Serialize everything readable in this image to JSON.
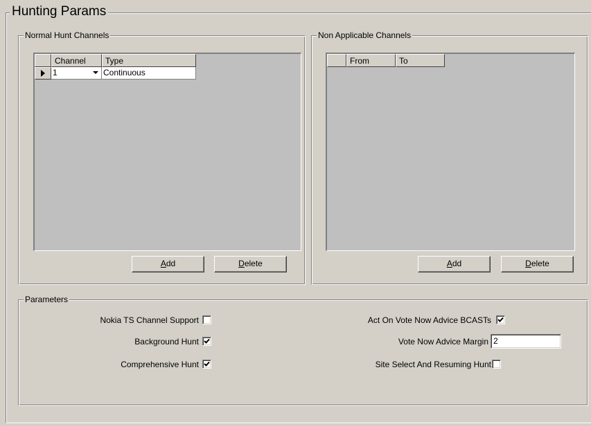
{
  "main_group": {
    "title": "Hunting Params"
  },
  "normal_hunt": {
    "title": "Normal Hunt Channels",
    "columns": [
      "Channel",
      "Type"
    ],
    "rows": [
      {
        "channel": "1",
        "type": "Continuous"
      }
    ],
    "add_label_accel": "A",
    "add_label_rest": "dd",
    "delete_label_accel": "D",
    "delete_label_rest": "elete"
  },
  "non_applicable": {
    "title": "Non Applicable Channels",
    "columns": [
      "From",
      "To"
    ],
    "add_label_accel": "A",
    "add_label_rest": "dd",
    "delete_label_accel": "D",
    "delete_label_rest": "elete"
  },
  "parameters": {
    "title": "Parameters",
    "left": [
      {
        "label": "Nokia TS Channel Support",
        "checked": false
      },
      {
        "label": "Background Hunt",
        "checked": true
      },
      {
        "label": "Comprehensive Hunt",
        "checked": true
      }
    ],
    "right": {
      "act_on_vote": {
        "label": "Act On  Vote Now Advice BCASTs",
        "checked": true
      },
      "vote_margin": {
        "label": "Vote Now Advice Margin",
        "value": "2"
      },
      "site_select": {
        "label": "Site Select And Resuming Hunt",
        "checked": false
      }
    }
  }
}
